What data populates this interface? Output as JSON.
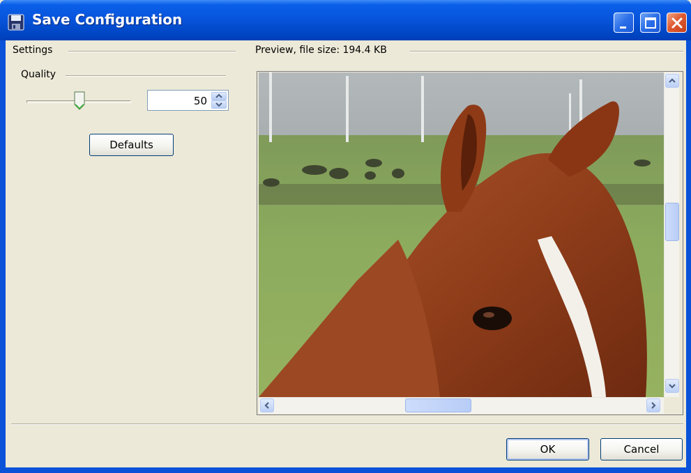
{
  "window": {
    "title": "Save Configuration"
  },
  "settings": {
    "group_label": "Settings",
    "quality_label": "Quality",
    "quality_value": "50",
    "quality_slider_fraction": 0.5,
    "defaults_button": "Defaults"
  },
  "preview": {
    "label": "Preview, file size: 194.4 KB",
    "image_subject": "horse head close-up in green pasture with wind turbines"
  },
  "footer": {
    "ok_button": "OK",
    "cancel_button": "Cancel"
  },
  "icons": {
    "title": "floppy-disk-icon",
    "minimize": "minimize-icon",
    "maximize": "maximize-icon",
    "close": "close-icon"
  },
  "colors": {
    "titlebar": "#0855dd",
    "client_bg": "#ece9d8",
    "close_button": "#e05b32"
  }
}
